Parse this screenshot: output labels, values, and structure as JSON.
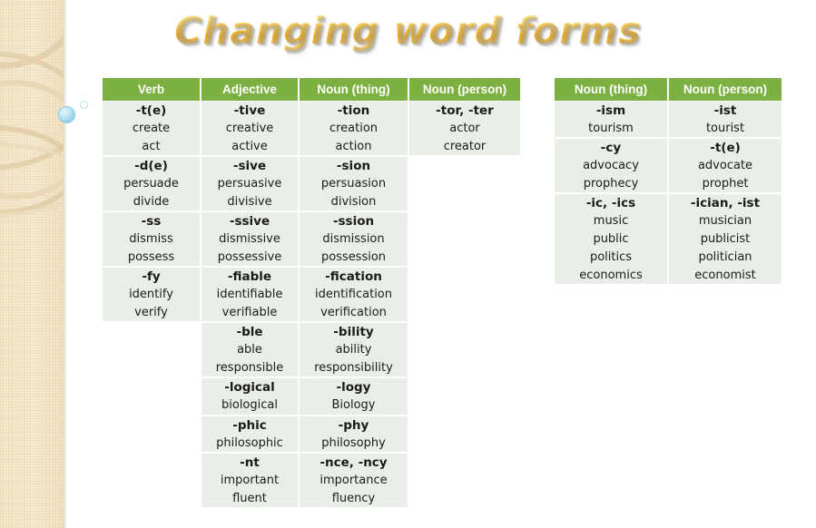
{
  "slide": {
    "title": "Changing word forms",
    "accent_green": "#7cb142",
    "cell_bg": "#e9eee7",
    "title_gold": "#eaa81f",
    "band_beige": "#f6e9cf",
    "bubble_blue": "#b7e2ef"
  },
  "decor": {
    "band_name": "beige-textured-side-band",
    "bubble_large": "blue-bubble",
    "bubble_small": "small-outline-bubble"
  },
  "left_table": {
    "headers": [
      "Verb",
      "Adjective",
      "Noun (thing)",
      "Noun (person)"
    ],
    "groups": [
      {
        "verb": [
          "-t(e)",
          "create",
          "act"
        ],
        "adjective": [
          "-tive",
          "creative",
          "active"
        ],
        "noun_thing": [
          "-tion",
          "creation",
          "action"
        ],
        "noun_person": [
          "-tor, -ter",
          "actor",
          "creator"
        ]
      },
      {
        "verb": [
          "-d(e)",
          "persuade",
          "divide"
        ],
        "adjective": [
          "-sive",
          "persuasive",
          "divisive"
        ],
        "noun_thing": [
          "-sion",
          "persuasion",
          "division"
        ],
        "noun_person": []
      },
      {
        "verb": [
          "-ss",
          "dismiss",
          "possess"
        ],
        "adjective": [
          "-ssive",
          "dismissive",
          "possessive"
        ],
        "noun_thing": [
          "-ssion",
          "dismission",
          "possession"
        ],
        "noun_person": []
      },
      {
        "verb": [
          "-fy",
          "identify",
          "verify"
        ],
        "adjective": [
          "-fiable",
          "identifiable",
          "verifiable"
        ],
        "noun_thing": [
          "-fication",
          "identification",
          "verification"
        ],
        "noun_person": []
      },
      {
        "verb": [],
        "adjective": [
          "-ble",
          "able",
          "responsible"
        ],
        "noun_thing": [
          "-bility",
          "ability",
          "responsibility"
        ],
        "noun_person": []
      },
      {
        "verb": [],
        "adjective": [
          "-logical",
          "biological"
        ],
        "noun_thing": [
          "-logy",
          "Biology"
        ],
        "noun_person": []
      },
      {
        "verb": [],
        "adjective": [
          "-phic",
          "philosophic"
        ],
        "noun_thing": [
          "-phy",
          "philosophy"
        ],
        "noun_person": []
      },
      {
        "verb": [],
        "adjective": [
          "-nt",
          "important",
          "fluent"
        ],
        "noun_thing": [
          "-nce, -ncy",
          "importance",
          "fluency"
        ],
        "noun_person": []
      }
    ]
  },
  "right_table": {
    "headers": [
      "Noun (thing)",
      "Noun (person)"
    ],
    "groups": [
      {
        "noun_thing": [
          "-ism",
          "tourism"
        ],
        "noun_person": [
          "-ist",
          "tourist"
        ]
      },
      {
        "noun_thing": [
          "-cy",
          "advocacy",
          "prophecy"
        ],
        "noun_person": [
          "-t(e)",
          "advocate",
          "prophet"
        ]
      },
      {
        "noun_thing": [
          "-ic, -ics",
          "music",
          "public",
          "politics",
          "economics"
        ],
        "noun_person": [
          "-ician, -ist",
          "musician",
          "publicist",
          "politician",
          "economist"
        ]
      }
    ]
  }
}
